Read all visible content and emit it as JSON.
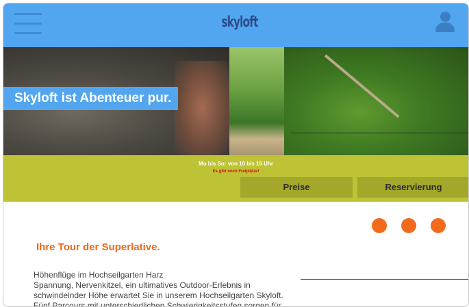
{
  "header": {
    "logo": "skyloft"
  },
  "hero": {
    "tagline": "Skyloft ist Abenteuer pur."
  },
  "info": {
    "hours": "Mo bis So: von 10 bis 16 Uhr",
    "availability": "Es gibt noch Freiplätze!",
    "buttons": {
      "prices": "Preise",
      "reservation": "Reservierung"
    }
  },
  "content": {
    "title": "Ihre Tour der Superlative.",
    "lines": [
      "Höhenflüge im Hochseilgarten Harz",
      "Spannung, Nervenkitzel, ein ultimatives Outdoor-Erlebnis in",
      "schwindelnder Höhe erwartet Sie in unserem Hochseilgarten Skyloft.",
      "Fünf Parcours mit unterschiedlichen Schwierigkeitsstufen sorgen für"
    ]
  },
  "colors": {
    "header": "#52a6f0",
    "band": "#bec335",
    "button": "#a3a82a",
    "accent": "#f26a1b",
    "alert": "#d40f0f"
  },
  "icons": [
    "hamburger-menu-icon",
    "user-icon"
  ]
}
